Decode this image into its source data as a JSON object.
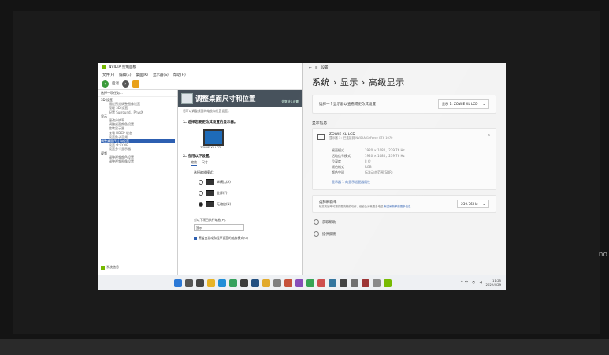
{
  "monitor": {
    "brand": "no"
  },
  "nvidia": {
    "window_title": "NVIDIA 控制面板",
    "menu": [
      "文件(F)",
      "编辑(E)",
      "桌面(K)",
      "显示器(S)",
      "帮助(H)"
    ],
    "toolbar": {
      "back_label": "后退",
      "back_glyph": "‹",
      "forward_glyph": "›"
    },
    "task_header": "选择一项任务...",
    "tree": [
      {
        "text": "3D 设置",
        "type": "cat"
      },
      {
        "text": "通过预览调整图像设置",
        "type": "it"
      },
      {
        "text": "管理 3D 设置",
        "type": "it"
      },
      {
        "text": "配置 Surround、PhysX",
        "type": "it"
      },
      {
        "text": "显示",
        "type": "cat"
      },
      {
        "text": "更改分辨率",
        "type": "it"
      },
      {
        "text": "调整桌面颜色设置",
        "type": "it"
      },
      {
        "text": "旋转显示器",
        "type": "it"
      },
      {
        "text": "查看 HDCP 状态",
        "type": "it"
      },
      {
        "text": "设置数字音频",
        "type": "it"
      },
      {
        "text": "调整桌面尺寸和位置",
        "type": "sel"
      },
      {
        "text": "设置 G-SYNC",
        "type": "it"
      },
      {
        "text": "设置多个显示器",
        "type": "it"
      },
      {
        "text": "视频",
        "type": "cat"
      },
      {
        "text": "调整视频颜色设置",
        "type": "it"
      },
      {
        "text": "调整视频图像设置",
        "type": "it"
      }
    ],
    "system_info": "系统信息",
    "page_title": "调整桌面尺寸和位置",
    "restore_defaults": "恢复默认设置",
    "page_desc": "您可以调整桌面的缩放和位置设置。",
    "step1": "1. 选择您要更改其设置的显示器。",
    "monitor_label": "ZOWIE XL LCD",
    "step2": "2. 应用以下设置。",
    "tabs": [
      "缩放",
      "尺寸"
    ],
    "scaling_mode_title": "选择缩放模式：",
    "scaling_options": [
      {
        "label": "纵横比(A)",
        "selected": false
      },
      {
        "label": "全屏(F)",
        "selected": false
      },
      {
        "label": "无缩放(N)",
        "selected": true
      }
    ],
    "perform_scaling_on": "对以下项目执行缩放(P)：",
    "scaling_target": "显示",
    "override_check": "覆盖由游戏和程序设置的缩放模式(O)"
  },
  "settings": {
    "window_title": "设置",
    "breadcrumb": "系统 › 显示 › 高级显示",
    "select_display_text": "选择一个显示器以查看或更改其设置",
    "select_display_value": "显示 1: ZOWIE XL LCD",
    "section": "显示信息",
    "display_name": "ZOWIE XL LCD",
    "display_sub": "显示器 1：已连接到 NVIDIA GeForce GTX 1070",
    "info": [
      {
        "k": "桌面模式",
        "v": "1920 × 1080，239.76 Hz"
      },
      {
        "k": "活动信号模式",
        "v": "1920 × 1080，239.76 Hz"
      },
      {
        "k": "位深度",
        "v": "8 位"
      },
      {
        "k": "颜色格式",
        "v": "RGB"
      },
      {
        "k": "颜色空间",
        "v": "标准动态范围(SDR)"
      }
    ],
    "adapter_link": "显示器 1 的显示适配器属性",
    "refresh_title": "选择刷新率",
    "refresh_desc_pre": "较高的速率可提供更流畅的动作，但也会消耗更多电量",
    "refresh_desc_link": "有关刷新率的更多信息",
    "refresh_value": "239.76 Hz",
    "help_items": [
      "获取帮助",
      "提供反馈"
    ]
  },
  "taskbar": {
    "tray_text": "^ 中",
    "time": "11:25",
    "date": "2022/4/29"
  }
}
